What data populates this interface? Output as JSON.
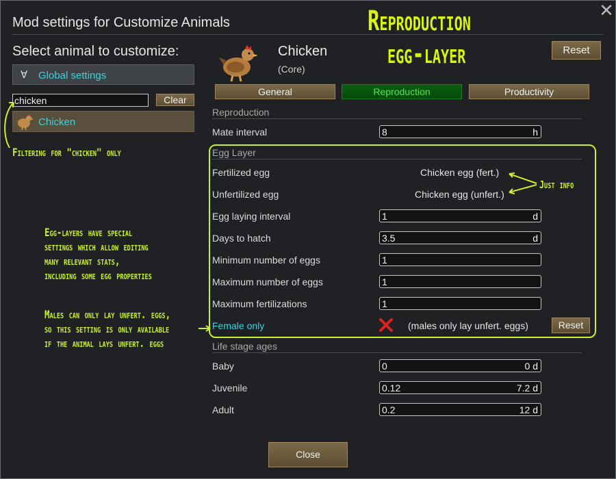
{
  "window": {
    "title": "Mod settings for Customize Animals",
    "close_glyph": "✕"
  },
  "sidebar": {
    "heading": "Select animal to customize:",
    "global_settings": {
      "symbol": "∀",
      "label": "Global settings"
    },
    "filter": {
      "value": "chicken"
    },
    "clear_label": "Clear",
    "animals": [
      {
        "label": "Chicken",
        "icon": "chicken-icon"
      }
    ]
  },
  "header": {
    "animal_name": "Chicken",
    "animal_source": "(Core)",
    "reset_label": "Reset"
  },
  "tabs": [
    {
      "label": "General",
      "active": false
    },
    {
      "label": "Reproduction",
      "active": true
    },
    {
      "label": "Productivity",
      "active": false
    }
  ],
  "reproduction": {
    "section_title": "Reproduction",
    "mate_interval": {
      "label": "Mate interval",
      "value": "8",
      "unit": "h"
    }
  },
  "egg_layer": {
    "section_title": "Egg Layer",
    "fertilized_egg": {
      "label": "Fertilized egg",
      "value": "Chicken egg (fert.)"
    },
    "unfertilized_egg": {
      "label": "Unfertilized egg",
      "value": "Chicken egg (unfert.)"
    },
    "laying_interval": {
      "label": "Egg laying interval",
      "value": "1",
      "unit": "d"
    },
    "days_to_hatch": {
      "label": "Days to hatch",
      "value": "3.5",
      "unit": "d"
    },
    "min_eggs": {
      "label": "Minimum number of eggs",
      "value": "1"
    },
    "max_eggs": {
      "label": "Maximum number of eggs",
      "value": "1"
    },
    "max_fert": {
      "label": "Maximum fertilizations",
      "value": "1"
    },
    "female_only": {
      "label": "Female only",
      "note": "(males only lay unfert. eggs)",
      "reset_label": "Reset",
      "checked": false
    }
  },
  "life_stages": {
    "section_title": "Life stage ages",
    "stages": [
      {
        "label": "Baby",
        "value": "0",
        "days": "0 d"
      },
      {
        "label": "Juvenile",
        "value": "0.12",
        "days": "7.2 d"
      },
      {
        "label": "Adult",
        "value": "0.2",
        "days": "12 d"
      }
    ]
  },
  "footer": {
    "close_label": "Close"
  },
  "annotations": {
    "headline_1": "Reproduction",
    "headline_2": "egg-layer",
    "filtering": "Filtering for \"chicken\" only",
    "just_info": "Just info",
    "egg_layers": [
      "Egg-layers have special",
      "settings which allow editing",
      "many relevant stats,",
      "including some egg properties"
    ],
    "males": [
      "Males can only lay unfert. eggs,",
      "so this setting is only available",
      "if the animal lays unfert. eggs"
    ]
  },
  "colors": {
    "accent_cyan": "#39d3e0",
    "annotation": "#c9f227",
    "active_tab": "#0b5e12",
    "button": "#6d5c3e",
    "cross": "#e02020"
  }
}
